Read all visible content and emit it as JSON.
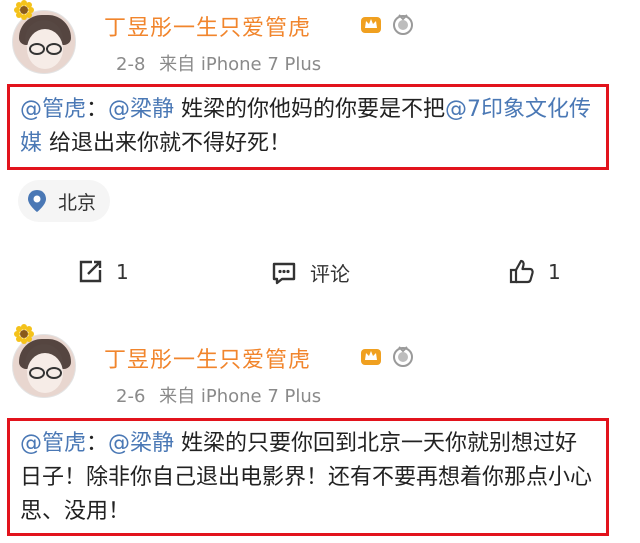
{
  "posts": [
    {
      "username": "丁昱彤一生只爱管虎",
      "date": "2-8",
      "source": "来自 iPhone 7 Plus",
      "quote": {
        "mention1": "@管虎",
        "sep": "：",
        "mention2": "@梁静",
        "text1": " 姓梁的你他妈的你要是不把",
        "mention3": "@7印象文化传媒",
        "text2": " 给退出来你就不得好死！"
      },
      "location": "北京",
      "actions": {
        "repost": "1",
        "comment": "评论",
        "like": "1"
      }
    },
    {
      "username": "丁昱彤一生只爱管虎",
      "date": "2-6",
      "source": "来自 iPhone 7 Plus",
      "quote": {
        "mention1": "@管虎",
        "sep": "：",
        "mention2": "@梁静",
        "text1": " 姓梁的只要你回到北京一天你就别想过好日子！除非你自己退出电影界！还有不要再想着你那点小心思、没用！"
      }
    }
  ],
  "colors": {
    "username": "#f1852c",
    "mention": "#4a78b5",
    "highlight_border": "#e2131c",
    "meta": "#8a8a8a"
  },
  "icons": [
    "sunflower-icon",
    "crown-badge-icon",
    "medal-badge-icon",
    "location-pin-icon",
    "repost-icon",
    "comment-icon",
    "like-icon"
  ]
}
